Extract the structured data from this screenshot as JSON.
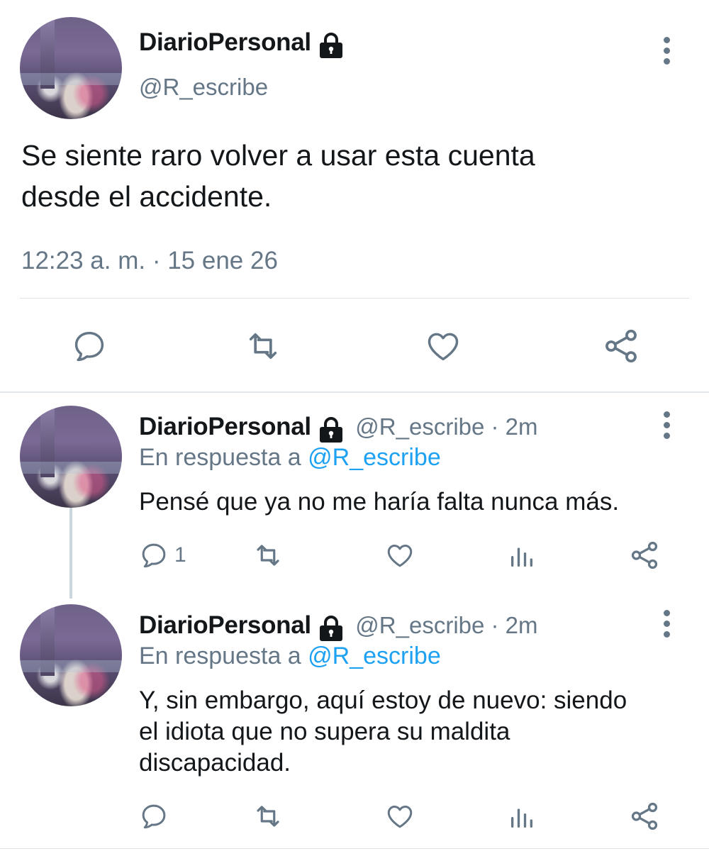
{
  "colors": {
    "text": "#14171a",
    "muted": "#657786",
    "link": "#1da1f2",
    "divider": "#dfe3e6"
  },
  "main_tweet": {
    "display_name": "DiarioPersonal",
    "handle": "@R_escribe",
    "lock_icon": "lock-icon",
    "text_line1": "Se siente raro volver a usar esta cuenta",
    "text_line2": "desde el accidente.",
    "timestamp": "12:23 a. m. · 15 ene 26",
    "actions": [
      "reply-icon",
      "retweet-icon",
      "like-icon",
      "share-icon"
    ]
  },
  "replies": [
    {
      "display_name": "DiarioPersonal",
      "handle_time": "@R_escribe · 2m",
      "reply_prefix": "En respuesta a",
      "reply_mention": "@R_escribe",
      "text_lines": [
        "Pensé que ya no me haría falta nunca más."
      ],
      "reply_count": "1"
    },
    {
      "display_name": "DiarioPersonal",
      "handle_time": "@R_escribe · 2m",
      "reply_prefix": "En respuesta a",
      "reply_mention": "@R_escribe",
      "text_lines": [
        "Y, sin embargo, aquí estoy de nuevo: siendo",
        "el idiota que no supera su maldita",
        "discapacidad."
      ],
      "reply_count": ""
    }
  ]
}
